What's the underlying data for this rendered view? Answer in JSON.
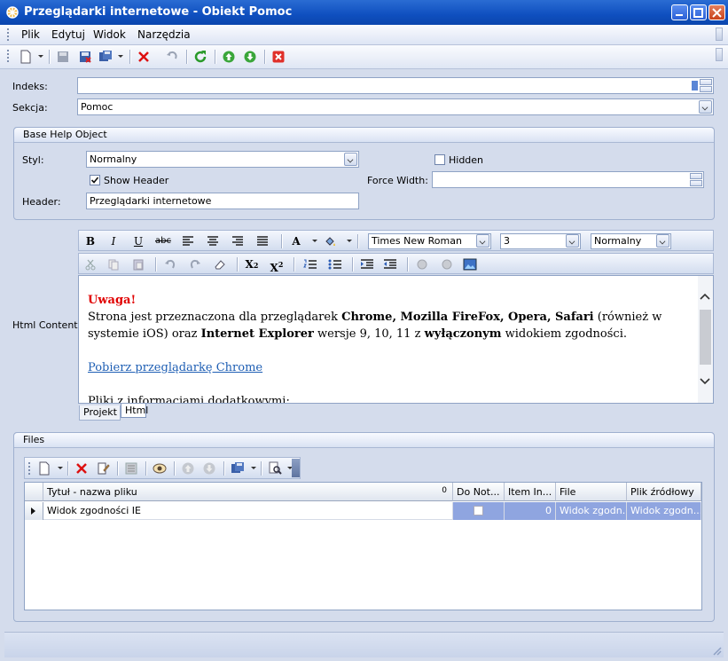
{
  "window": {
    "title": "Przeglądarki internetowe - Obiekt Pomoc"
  },
  "menu": {
    "items": [
      "Plik",
      "Edytuj",
      "Widok",
      "Narzędzia"
    ]
  },
  "form": {
    "indeks_label": "Indeks:",
    "indeks_value": "",
    "sekcja_label": "Sekcja:",
    "sekcja_value": "Pomoc"
  },
  "base_help": {
    "title": "Base Help Object",
    "styl_label": "Styl:",
    "styl_value": "Normalny",
    "hidden_label": "Hidden",
    "hidden_checked": false,
    "show_header_label": "Show Header",
    "show_header_checked": true,
    "force_width_label": "Force Width:",
    "force_width_value": "",
    "header_label": "Header:",
    "header_value": "Przeglądarki internetowe"
  },
  "editor": {
    "label": "Html Content:",
    "font_name": "Times New Roman",
    "font_size": "3",
    "paragraph": "Normalny",
    "content": {
      "warning": "Uwaga!",
      "p1_a": "Strona jest przeznaczona dla przeglądarek ",
      "p1_b": "Chrome, Mozilla FireFox, Opera, Safari",
      "p1_c": " (również w systemie iOS) oraz ",
      "p1_d": "Internet Explorer",
      "p1_e": " wersje 9, 10, 11 z ",
      "p1_f": "wyłączonym",
      "p1_g": " widokiem zgodności.",
      "link": "Pobierz przeglądarkę Chrome",
      "p2": "Pliki z informacjami dodatkowymi:"
    },
    "tabs": [
      "Projekt",
      "Html"
    ],
    "active_tab": "Html"
  },
  "files": {
    "title": "Files",
    "columns": [
      "Tytuł - nazwa pliku",
      "Do Not...",
      "Item In...",
      "File",
      "Plik źródłowy"
    ],
    "sort_badge": "0",
    "rows": [
      {
        "title": "Widok zgodności IE",
        "do_not": false,
        "item_index": "0",
        "file": "Widok zgodn...",
        "source": "Widok zgodn..."
      }
    ]
  },
  "colors": {
    "title_bar": "#0f4fbf",
    "selection": "#8fa5e0",
    "warning": "#e00000",
    "link": "#1f5fb4"
  }
}
